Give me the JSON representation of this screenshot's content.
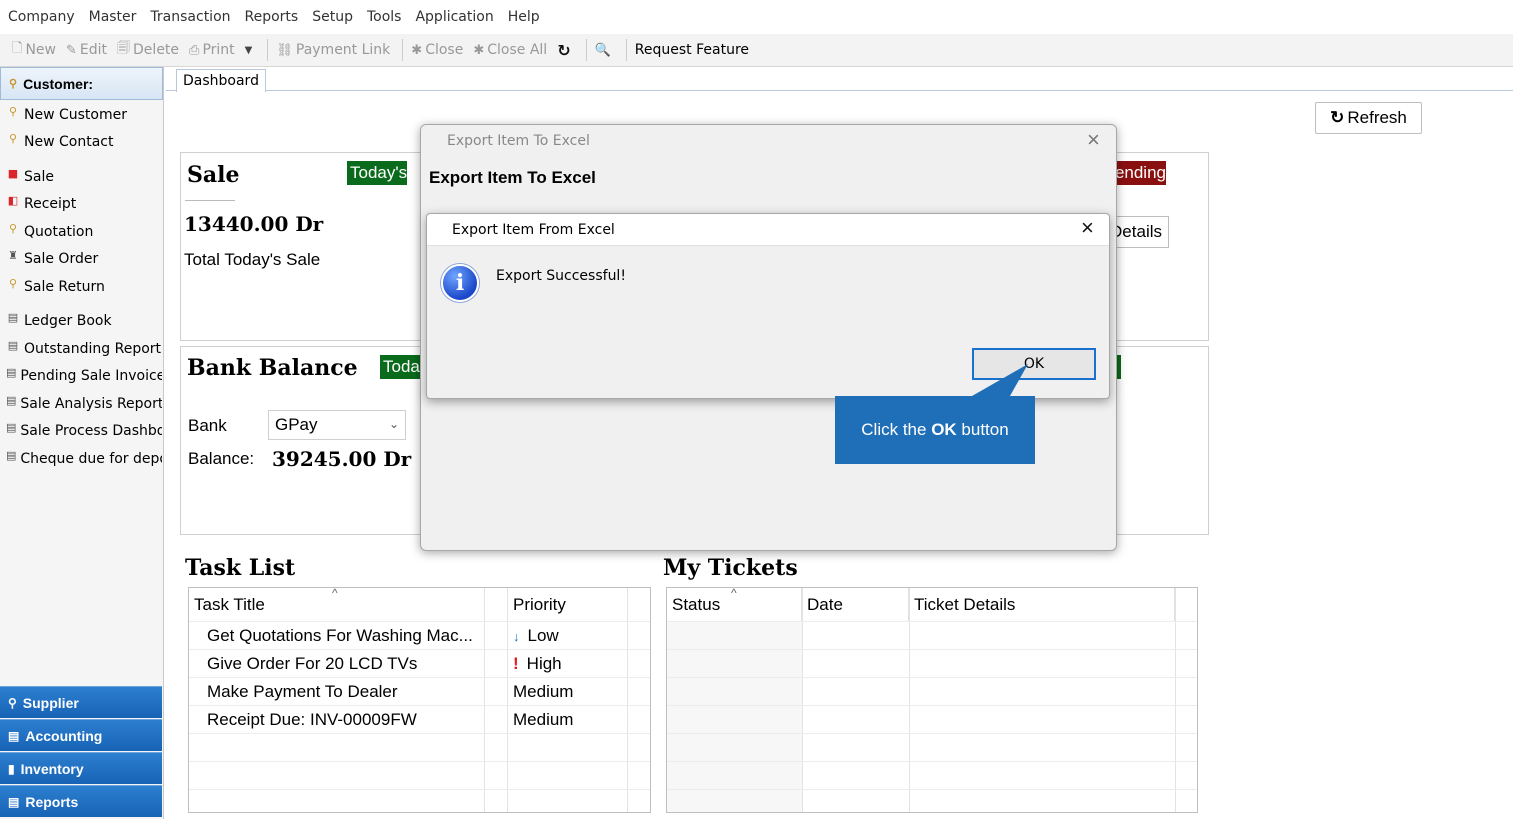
{
  "menu": [
    "Company",
    "Master",
    "Transaction",
    "Reports",
    "Setup",
    "Tools",
    "Application",
    "Help"
  ],
  "toolbar": {
    "new": "New",
    "edit": "Edit",
    "delete": "Delete",
    "print": "Print",
    "payment_link": "Payment Link",
    "close": "Close",
    "close_all": "Close All",
    "request_feature": "Request Feature"
  },
  "sidebar": {
    "header": "Customer:",
    "items": [
      {
        "label": "New Customer",
        "icon": "person-icon"
      },
      {
        "label": "New Contact",
        "icon": "person-icon"
      },
      {
        "label": "Sale",
        "icon": "sale-icon"
      },
      {
        "label": "Receipt",
        "icon": "receipt-icon"
      },
      {
        "label": "Quotation",
        "icon": "person-icon"
      },
      {
        "label": "Sale Order",
        "icon": "order-icon"
      },
      {
        "label": "Sale Return",
        "icon": "person-icon"
      },
      {
        "label": "Ledger Book",
        "icon": "report-icon"
      },
      {
        "label": "Outstanding Report",
        "icon": "report-icon"
      },
      {
        "label": "Pending Sale Invoices",
        "icon": "report-icon"
      },
      {
        "label": "Sale Analysis Report",
        "icon": "report-icon"
      },
      {
        "label": "Sale Process Dashboard",
        "icon": "report-icon"
      },
      {
        "label": "Cheque due for deposit",
        "icon": "report-icon"
      }
    ],
    "categories": [
      "Supplier",
      "Accounting",
      "Inventory",
      "Reports"
    ]
  },
  "tabs": {
    "dashboard": "Dashboard"
  },
  "refresh_label": "Refresh",
  "sale": {
    "title": "Sale",
    "badge": "Today's",
    "amount": "13440.00 Dr",
    "caption": "Total Today's Sale",
    "pending_badge": "Pending",
    "details_button": "Details"
  },
  "bank": {
    "title": "Bank Balance",
    "badge": "Today",
    "bank_label": "Bank",
    "bank_value": "GPay",
    "balance_label": "Balance:",
    "balance_value": "39245.00 Dr"
  },
  "task_list": {
    "title": "Task List",
    "columns": [
      "Task Title",
      "Priority"
    ],
    "rows": [
      {
        "title": "Get Quotations For Washing Mac...",
        "priority": "Low",
        "marker": "↓",
        "marker_color": "#1a6fc4"
      },
      {
        "title": "Give Order For 20 LCD TVs",
        "priority": "High",
        "marker": "!",
        "marker_color": "#e01b1b"
      },
      {
        "title": "Make Payment To Dealer",
        "priority": "Medium",
        "marker": "",
        "marker_color": ""
      },
      {
        "title": "Receipt Due: INV-00009FW",
        "priority": "Medium",
        "marker": "",
        "marker_color": ""
      }
    ]
  },
  "tickets": {
    "title": "My Tickets",
    "columns": [
      "Status",
      "Date",
      "Ticket Details"
    ]
  },
  "dialog_back": {
    "window_title": "Export Item To Excel",
    "heading": "Export Item To Excel"
  },
  "dialog_front": {
    "window_title": "Export Item From Excel",
    "message": "Export Successful!",
    "ok_label": "OK"
  },
  "callout": {
    "prefix": "Click the ",
    "bold": "OK",
    "suffix": " button"
  },
  "colors": {
    "accent_blue": "#1f6fb8",
    "badge_green": "#0a6b1c",
    "badge_red": "#8a1010"
  }
}
